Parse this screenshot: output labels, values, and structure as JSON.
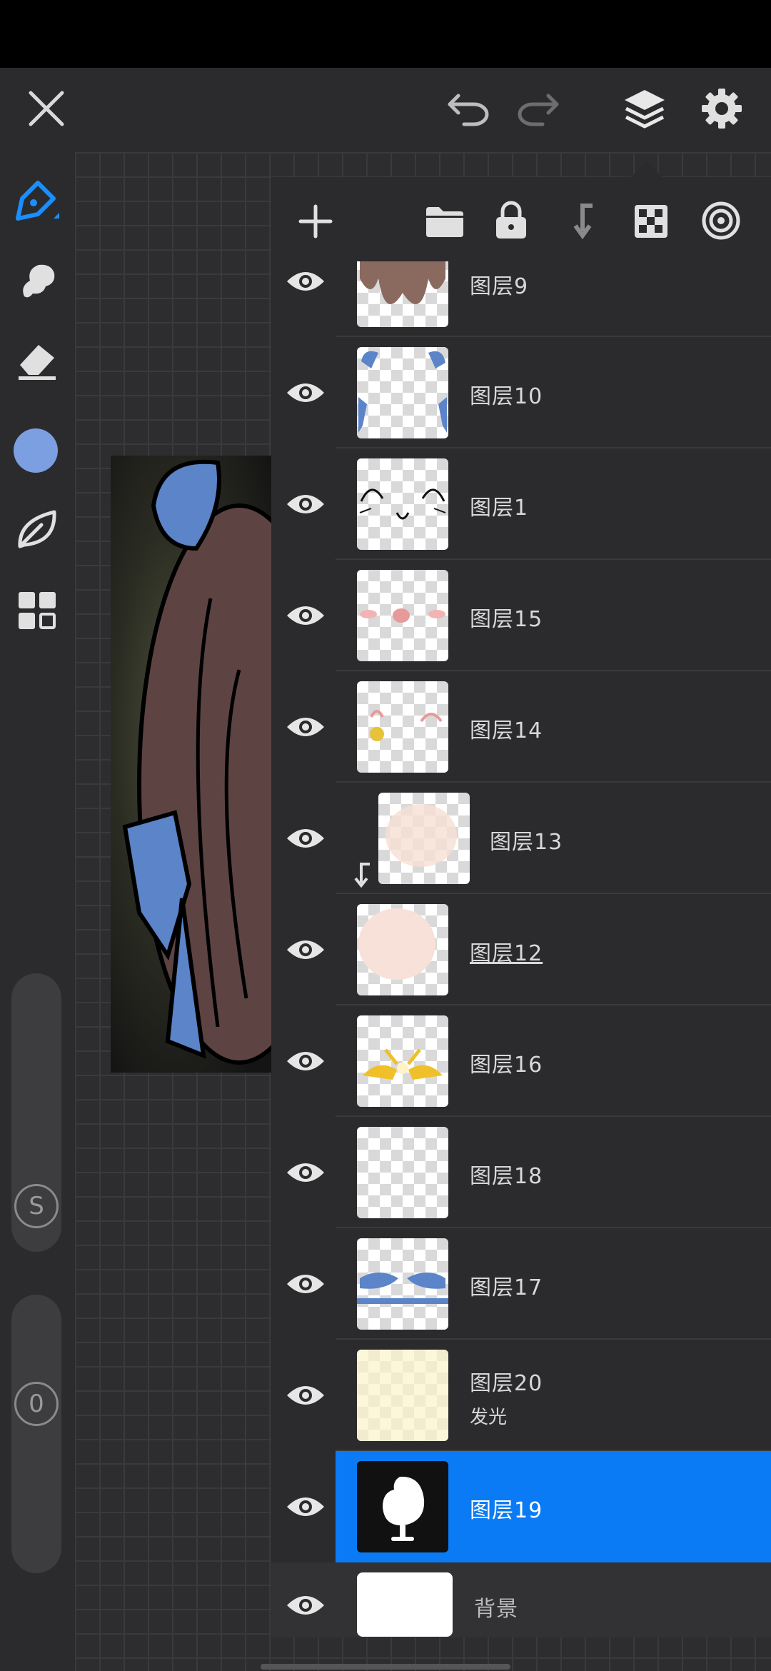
{
  "toolbar": {
    "close": "close-icon",
    "undo": "undo-icon",
    "redo": "redo-icon",
    "layers": "layers-icon",
    "settings": "gear-icon"
  },
  "tools": {
    "brush_color": "#7b9fe0",
    "accent": "#1a8fff",
    "slider_s_label": "S",
    "slider_o_label": "0"
  },
  "layers_panel": {
    "actions": [
      "add-layer-icon",
      "folder-icon",
      "lock-icon",
      "clip-mask-icon",
      "transparency-lock-icon",
      "blend-mode-icon"
    ],
    "layers": [
      {
        "name": "图层9",
        "sub": "",
        "visible": true
      },
      {
        "name": "图层10",
        "sub": "",
        "visible": true
      },
      {
        "name": "图层1",
        "sub": "",
        "visible": true
      },
      {
        "name": "图层15",
        "sub": "",
        "visible": true
      },
      {
        "name": "图层14",
        "sub": "",
        "visible": true
      },
      {
        "name": "图层13",
        "sub": "",
        "visible": true
      },
      {
        "name": "图层12",
        "sub": "",
        "visible": true
      },
      {
        "name": "图层16",
        "sub": "",
        "visible": true
      },
      {
        "name": "图层18",
        "sub": "",
        "visible": true
      },
      {
        "name": "图层17",
        "sub": "",
        "visible": true
      },
      {
        "name": "图层20",
        "sub": "发光",
        "visible": true
      },
      {
        "name": "图层19",
        "sub": "",
        "visible": true
      },
      {
        "name": "背景",
        "sub": "",
        "visible": true
      }
    ],
    "selected_color": "#0a7bf5"
  }
}
